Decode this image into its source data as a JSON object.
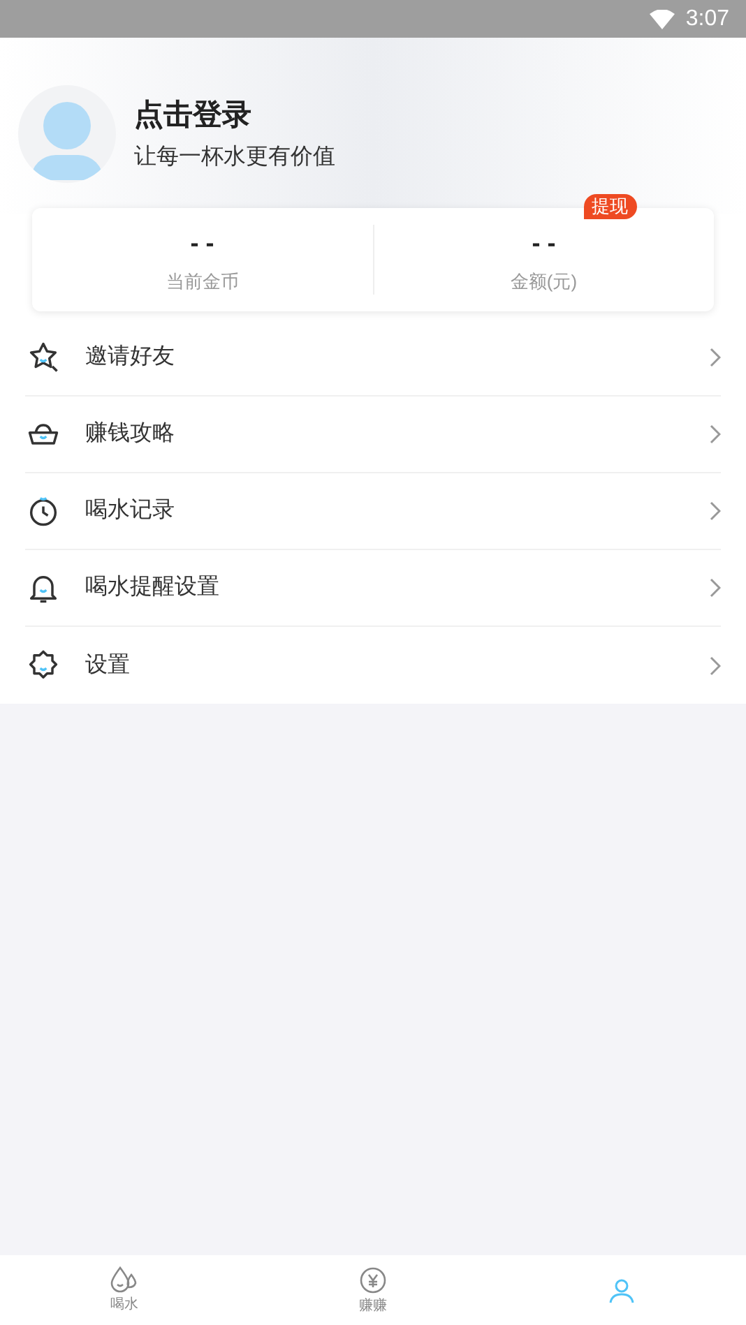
{
  "status_bar": {
    "time": "3:07"
  },
  "profile": {
    "title": "点击登录",
    "subtitle": "让每一杯水更有价值"
  },
  "stats": [
    {
      "value": "- -",
      "label": "当前金币"
    },
    {
      "value": "- -",
      "label": "金额(元)",
      "badge": "提现"
    }
  ],
  "menu": [
    {
      "kind": "star",
      "label": "邀请好友"
    },
    {
      "kind": "ingot",
      "label": "赚钱攻略"
    },
    {
      "kind": "clock",
      "label": "喝水记录"
    },
    {
      "kind": "bell",
      "label": "喝水提醒设置"
    },
    {
      "kind": "gear",
      "label": "设置"
    }
  ],
  "tabs": [
    {
      "kind": "drops",
      "label": "喝水",
      "selected": false
    },
    {
      "kind": "coin",
      "label": "赚赚",
      "selected": false
    },
    {
      "kind": "user",
      "selected": true
    }
  ]
}
